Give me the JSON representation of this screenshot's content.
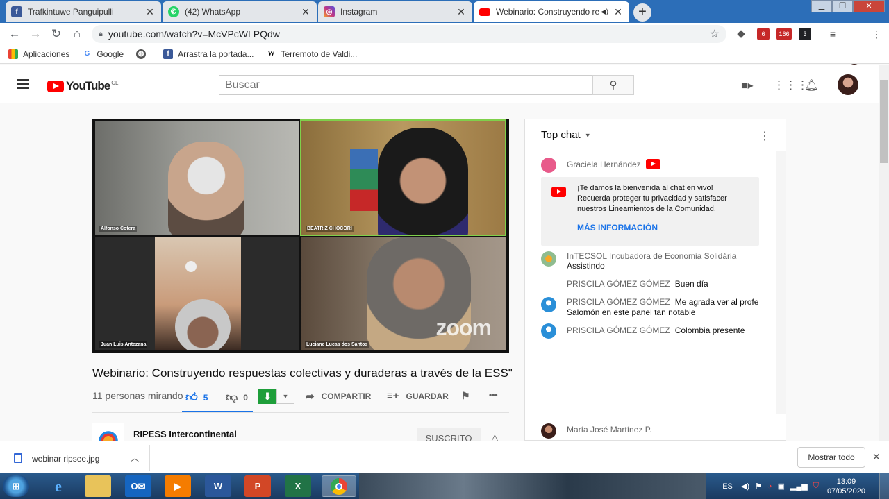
{
  "browser": {
    "tabs": [
      {
        "title": "Trafkintuwe Panguipulli",
        "icon": "facebook-icon",
        "color": "#3b5998"
      },
      {
        "title": "(42) WhatsApp",
        "icon": "whatsapp-icon",
        "color": "#25d366"
      },
      {
        "title": "Instagram",
        "icon": "instagram-icon",
        "color": "#c13584"
      },
      {
        "title": "Webinario: Construyendo re",
        "icon": "youtube-icon",
        "color": "#ff0000",
        "active": true
      }
    ],
    "url": "youtube.com/watch?v=McVPcWLPQdw",
    "extensions": [
      {
        "badge": "6",
        "color": "#c62828"
      },
      {
        "badge": "166",
        "color": "#c62828"
      },
      {
        "badge": "3",
        "color": "#202124"
      }
    ],
    "bookmarks": [
      {
        "label": "Aplicaciones",
        "icon": "apps-grid-icon"
      },
      {
        "label": "Google",
        "icon": "google-icon"
      },
      {
        "label": "",
        "icon": "globe-icon"
      },
      {
        "label": "Arrastra la portada...",
        "icon": "facebook-icon"
      },
      {
        "label": "Terremoto de Valdi...",
        "icon": "wikipedia-icon"
      }
    ]
  },
  "youtube": {
    "logo_text": "YouTube",
    "country": "CL",
    "search_placeholder": "Buscar"
  },
  "video": {
    "participants": [
      {
        "name": "Alfonso Cotera"
      },
      {
        "name": "BEATRIZ CHOCORI"
      },
      {
        "name": "Juan Luis Antezana"
      },
      {
        "name": "Luciane Lucas dos Santos"
      }
    ],
    "watermark": "zoom",
    "title": "Webinario: Construyendo respuestas colectivas y duraderas a través de la ESS\"",
    "viewers": "11 personas mirando",
    "likes": "5",
    "dislikes": "0",
    "share_label": "COMPARTIR",
    "save_label": "GUARDAR",
    "more_label": "•••"
  },
  "channel": {
    "name": "RIPESS Intercontinental",
    "subscribe_label": "SUSCRITO"
  },
  "chat": {
    "header": "Top chat",
    "messages": [
      {
        "author": "Graciela Hernández",
        "text": "",
        "avatar_color": "#e85a8a"
      },
      {
        "author": "InTECSOL Incubadora de Economia Solidária",
        "text": "Assistindo",
        "avatar_color": "#8fbc8f"
      },
      {
        "author": "PRISCILA GÓMEZ GÓMEZ",
        "text": "Buen día",
        "avatar_color": ""
      },
      {
        "author": "PRISCILA GÓMEZ GÓMEZ",
        "text": "Me agrada ver al profe Salomón en este panel tan notable",
        "avatar_color": "#2a8fd8"
      },
      {
        "author": "PRISCILA GÓMEZ GÓMEZ",
        "text": "Colombia presente",
        "avatar_color": "#2a8fd8"
      },
      {
        "author": "María José Martínez P.",
        "text": "",
        "avatar_color": "#5a2a20"
      }
    ],
    "welcome": {
      "line1": "¡Te damos la bienvenida al chat en vivo!",
      "line2": "Recuerda proteger tu privacidad y satisfacer nuestros Lineamientos de la Comunidad.",
      "more": "MÁS INFORMACIÓN"
    }
  },
  "downloads": {
    "file": "webinar ripsee.jpg",
    "show_all": "Mostrar todo"
  },
  "taskbar": {
    "lang": "ES",
    "time": "13:09",
    "date": "07/05/2020"
  }
}
